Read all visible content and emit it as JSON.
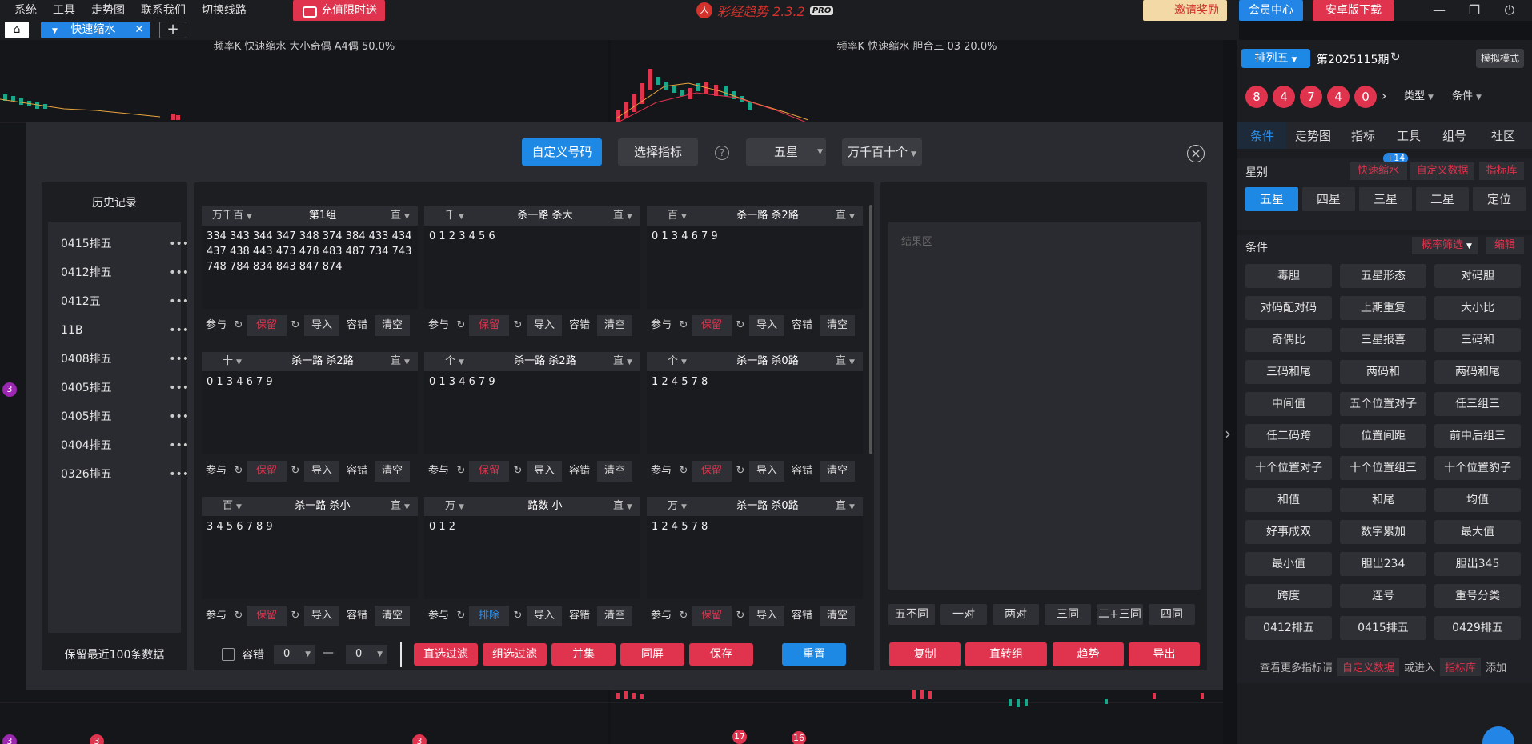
{
  "menu": [
    "系统",
    "工具",
    "走势图",
    "联系我们",
    "切换线路"
  ],
  "promo_label": "充值限时送",
  "brand": {
    "name": "彩经趋势 2.3.2",
    "badge": "PRO"
  },
  "invite_label": "邀请奖励",
  "vip_label": "会员中心",
  "apk_label": "安卓版下载",
  "tabs": {
    "active": "快速缩水"
  },
  "charts": {
    "left_title": "频率K  快速缩水  大小奇偶 A4偶  50.0%",
    "right_title": "频率K  快速缩水  胆合三 03  20.0%"
  },
  "modal": {
    "mode_custom": "自定义号码",
    "mode_indicator": "选择指标",
    "help": "?",
    "star_select": "五星",
    "pos_select": "万千百十个",
    "close": "×"
  },
  "history": {
    "title": "历史记录",
    "items": [
      "0415排五",
      "0412排五",
      "0412五",
      "11B",
      "0408排五",
      "0405排五",
      "0405排五",
      "0404排五",
      "0326排五"
    ],
    "footer": "保留最近100条数据"
  },
  "groups": [
    {
      "pos": "万千百",
      "title": "第1组",
      "mode": "直",
      "numbers": "334 343 344 347 348 374 384 433 434 437 438 443 473 478 483 487 734 743 748 784 834 843 847 874",
      "keep_color": "red"
    },
    {
      "pos": "千",
      "title": "杀一路 杀大",
      "mode": "直",
      "numbers": "0 1 2 3 4 5 6",
      "keep_color": "red"
    },
    {
      "pos": "百",
      "title": "杀一路 杀2路",
      "mode": "直",
      "numbers": "0 1 3 4 6 7 9",
      "keep_color": "red"
    },
    {
      "pos": "十",
      "title": "杀一路 杀2路",
      "mode": "直",
      "numbers": "0 1 3 4 6 7 9",
      "keep_color": "red"
    },
    {
      "pos": "个",
      "title": "杀一路 杀2路",
      "mode": "直",
      "numbers": "0 1 3 4 6 7 9",
      "keep_color": "red"
    },
    {
      "pos": "个",
      "title": "杀一路 杀0路",
      "mode": "直",
      "numbers": "1 2 4 5 7 8",
      "keep_color": "red"
    },
    {
      "pos": "百",
      "title": "杀一路 杀小",
      "mode": "直",
      "numbers": "3 4 5 6 7 8 9",
      "keep_color": "red"
    },
    {
      "pos": "万",
      "title": "路数 小",
      "mode": "直",
      "numbers": "0 1 2",
      "keep_color": "blue"
    },
    {
      "pos": "万",
      "title": "杀一路 杀0路",
      "mode": "直",
      "numbers": "1 2 4 5 7 8",
      "keep_color": "red"
    }
  ],
  "card_footer": {
    "ref": "参与",
    "keep": "保留",
    "exclude": "排除",
    "import": "导入",
    "tolerance": "容错",
    "clear": "清空"
  },
  "bottom": {
    "tol_label": "容错",
    "tol_from": "0",
    "dash": "—",
    "tol_to": "0",
    "filter_direct": "直选过滤",
    "filter_group": "组选过滤",
    "union": "并集",
    "same_screen": "同屏",
    "save": "保存",
    "reset": "重置"
  },
  "result": {
    "placeholder": "结果区",
    "stats": [
      "五不同",
      "一对",
      "两对",
      "三同",
      "二+三同",
      "四同"
    ],
    "actions": [
      "复制",
      "直转组",
      "趋势",
      "导出"
    ]
  },
  "side": {
    "lottery": "排列五",
    "issue": "第2025115期",
    "sim": "模拟模式",
    "balls": [
      "8",
      "4",
      "7",
      "4",
      "0"
    ],
    "type_label": "类型",
    "cond_label": "条件",
    "nav": [
      "条件",
      "走势图",
      "指标",
      "工具",
      "组号",
      "社区"
    ],
    "star_label": "星别",
    "badge": "+14",
    "quick": "快速缩水",
    "custom_data": "自定义数据",
    "lib": "指标库",
    "stars": [
      "五星",
      "四星",
      "三星",
      "二星",
      "定位"
    ],
    "cond_title": "条件",
    "prob_filter": "概率筛选",
    "edit": "编辑",
    "conditions": [
      "毒胆",
      "五星形态",
      "对码胆",
      "对码配对码",
      "上期重复",
      "大小比",
      "奇偶比",
      "三星报喜",
      "三码和",
      "三码和尾",
      "两码和",
      "两码和尾",
      "中间值",
      "五个位置对子",
      "任三组三",
      "任二码跨",
      "位置间距",
      "前中后组三",
      "十个位置对子",
      "十个位置组三",
      "十个位置豹子",
      "和值",
      "和尾",
      "均值",
      "好事成双",
      "数字累加",
      "最大值",
      "最小值",
      "胆出234",
      "胆出345",
      "跨度",
      "连号",
      "重号分类",
      "0412排五",
      "0415排五",
      "0429排五"
    ],
    "footer_text1": "查看更多指标请",
    "footer_link1": "自定义数据",
    "footer_text2": "或进入",
    "footer_link2": "指标库",
    "footer_text3": "添加"
  },
  "bg_markers": [
    "3",
    "3",
    "3",
    "17",
    "16",
    "3"
  ],
  "colors": {
    "accent_blue": "#1e88e5",
    "accent_red": "#e0334e"
  }
}
